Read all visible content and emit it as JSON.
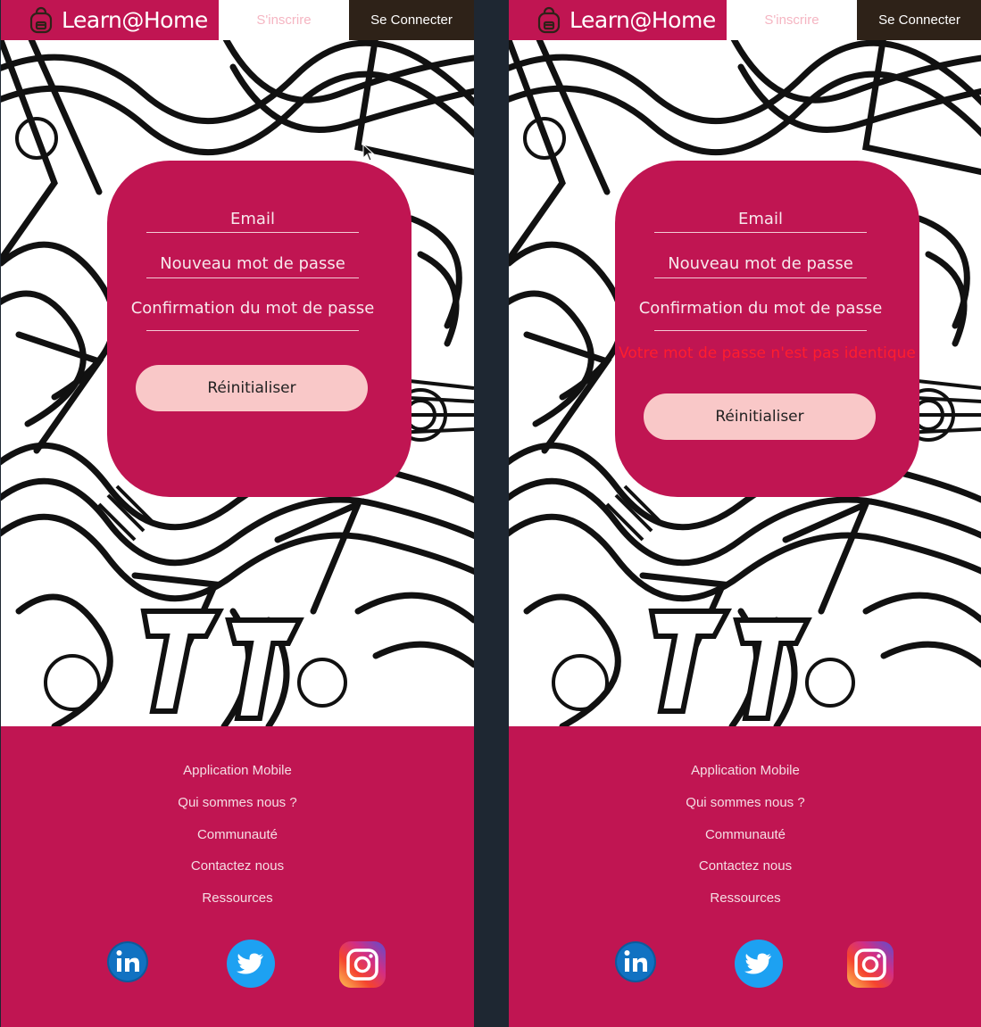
{
  "brand": {
    "name": "Learn@Home",
    "color": "#c01552"
  },
  "nav": {
    "signup_label": "S'inscrire",
    "login_label": "Se Connecter"
  },
  "form": {
    "email_placeholder": "Email",
    "new_password_placeholder": "Nouveau mot de passe",
    "confirm_password_placeholder": "Confirmation du mot de passe",
    "reset_label": "Réinitialiser",
    "error_message": "Votre mot de passe n'est pas identique"
  },
  "footer": {
    "links": [
      "Application Mobile",
      "Qui sommes nous ?",
      "Communauté",
      "Contactez nous",
      "Ressources"
    ],
    "social": [
      "linkedin-icon",
      "twitter-icon",
      "instagram-icon"
    ]
  },
  "colors": {
    "accent": "#c01552",
    "button": "#f9c8c8",
    "error": "#ff1d2e",
    "login_bg": "#2e2218"
  }
}
